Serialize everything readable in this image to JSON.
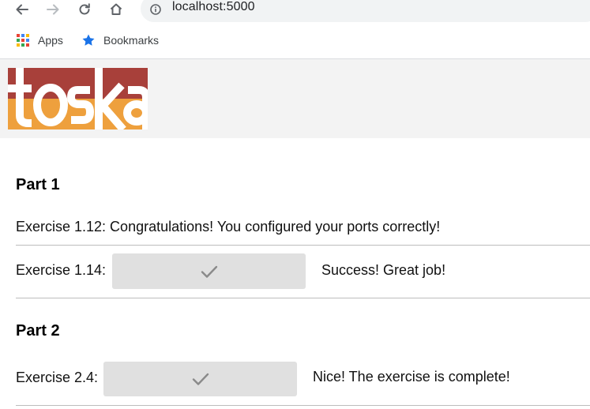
{
  "browser": {
    "url": "localhost:5000",
    "bookmarks": [
      {
        "label": "Apps",
        "icon": "apps-grid-icon"
      },
      {
        "label": "Bookmarks",
        "icon": "star-icon"
      }
    ]
  },
  "header": {
    "logo_text": "toska",
    "colors": {
      "top": "#a8403a",
      "bottom": "#eea03d",
      "background": "#f3f3f3"
    }
  },
  "parts": [
    {
      "title": "Part 1",
      "text_line": "Exercise 1.12: Congratulations! You configured your ports correctly!",
      "exercise": {
        "label": "Exercise 1.14:",
        "button_icon": "checkmark-icon",
        "message": "Success! Great job!"
      }
    },
    {
      "title": "Part 2",
      "exercise": {
        "label": "Exercise 2.4:",
        "button_icon": "checkmark-icon",
        "message": "Nice! The exercise is complete!"
      }
    }
  ]
}
